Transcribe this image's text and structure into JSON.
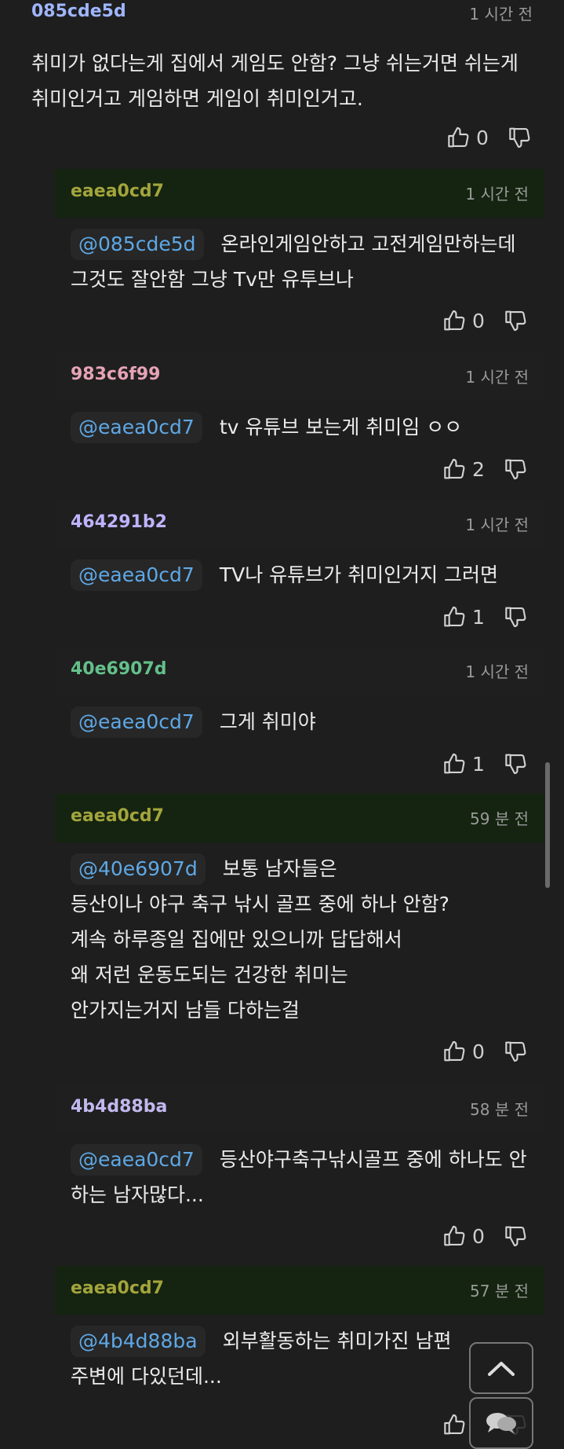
{
  "colors": {
    "background": "#1e1e1e",
    "op_reply_header": "#142410",
    "mention": "#5ea8e6",
    "author_085cde5d": "#9fb6ff",
    "author_eaea0cd7": "#a3a43c",
    "author_983c6f99": "#e6a3b6",
    "author_464291b2": "#bfb3ff",
    "author_40e6907d": "#64c08a",
    "author_4b4d88ba": "#c2b8ee"
  },
  "comments": [
    {
      "author": "085cde5d",
      "time": "1 시간 전",
      "lines": [
        "취미가 없다는게 집에서 게임도 안함? 그냥 쉬는거면 쉬는게",
        "취미인거고 게임하면 게임이 취미인거고."
      ],
      "likes": "0",
      "like_icon": "thumbs-up-icon",
      "dislike_icon": "thumbs-down-icon"
    },
    {
      "author": "eaea0cd7",
      "time": "1 시간 전",
      "mention": "@085cde5d",
      "lines": [
        "온라인게임안하고 고전게임만하는데",
        "그것도 잘안함 그냥 Tv만 유투브나"
      ],
      "likes": "0"
    },
    {
      "author": "983c6f99",
      "time": "1 시간 전",
      "mention": "@eaea0cd7",
      "lines": [
        "tv 유튜브 보는게 취미임 ㅇㅇ"
      ],
      "likes": "2"
    },
    {
      "author": "464291b2",
      "time": "1 시간 전",
      "mention": "@eaea0cd7",
      "lines": [
        "TV나 유튜브가 취미인거지 그러면"
      ],
      "likes": "1"
    },
    {
      "author": "40e6907d",
      "time": "1 시간 전",
      "mention": "@eaea0cd7",
      "lines": [
        "그게 취미야"
      ],
      "likes": "1"
    },
    {
      "author": "eaea0cd7",
      "time": "59 분 전",
      "mention": "@40e6907d",
      "lines": [
        "보통 남자들은",
        "등산이나 야구 축구 낚시 골프 중에 하나 안함?",
        "계속 하루종일 집에만 있으니까 답답해서",
        "왜 저런 운동도되는 건강한 취미는",
        "안가지는거지 남들 다하는걸"
      ],
      "likes": "0"
    },
    {
      "author": "4b4d88ba",
      "time": "58 분 전",
      "mention": "@eaea0cd7",
      "lines": [
        "등산야구축구낚시골프 중에 하나도 안",
        "하는 남자많다..."
      ],
      "likes": "0"
    },
    {
      "author": "eaea0cd7",
      "time": "57 분 전",
      "mention": "@4b4d88ba",
      "lines": [
        "외부활동하는 취미가진 남편",
        "주변에 다있던데..."
      ],
      "likes": ""
    }
  ],
  "fab": {
    "top_icon": "chevron-up-icon",
    "chat_icon": "chat-bubbles-icon"
  }
}
